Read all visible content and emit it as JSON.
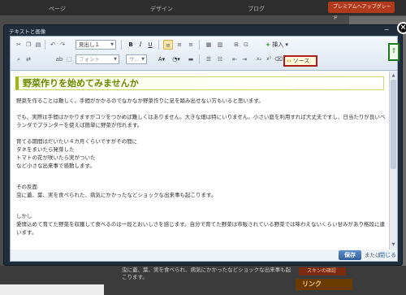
{
  "background": {
    "tabs": [
      "ページ",
      "デザイン",
      "ブログ"
    ],
    "premium_label": "プレミアムへアップグレード",
    "page_text": "虫に蓋、葉、実を食べられ、病気にかかったなどショックな出来事も起こります。",
    "sidebar_box": "スキンの確認",
    "link_heading": "リンク"
  },
  "dialog": {
    "title": "テキストと画像",
    "minimize_icon": "minus-icon",
    "close_icon": "close-icon"
  },
  "toolbar": {
    "format_select": "見出し１",
    "font_select": "フォント",
    "size_select": "サ...",
    "insert_label": "挿入",
    "source_label": "ソース",
    "icons": [
      "cut-icon",
      "copy-icon",
      "paste-icon",
      "undo-icon",
      "redo-icon",
      "bold-icon",
      "italic-icon",
      "underline-icon",
      "align-left-icon",
      "align-center-icon",
      "align-right-icon",
      "image-icon",
      "table-icon",
      "insert-plus-icon",
      "paste-text-icon",
      "paste-word-icon",
      "find-icon",
      "replace-icon",
      "font-color-icon",
      "background-color-icon",
      "strike-icon",
      "bullet-list-icon",
      "numbered-list-icon",
      "outdent-icon",
      "indent-icon",
      "subscript-icon",
      "superscript-icon",
      "eraser-icon",
      "quote-icon",
      "source-icon",
      "upload-icon"
    ]
  },
  "content": {
    "heading": "野菜作りを始めてみませんか",
    "paragraphs": [
      "野菜を作ることは難しく、手間がかかるのでなかなか野菜作りに足を踏み出せない方もいると思います。",
      "でも、実際は手間はかかりますがコツをつかめば難しくはありません。大きな畑は特にいりません。小さい庭を利用すれば大丈夫ですし、日当たりが良いベランダでプランターを使えば簡単に野菜が作れます。",
      "育てる期間はだいたい４カ月くらいですがその間に",
      "タネをまいたら発芽した",
      "トマトの花が咲いたら実がついた",
      "など小さな出来事で感動します。",
      "その反面",
      "虫に蓋、葉、実を食べられた、病気にかかったなどショックな出来事も起こります。",
      "しかし",
      "愛情込めて育てた野菜を収穫して食べるのは一段とおいしさを感じます。自分で育てた野菜は市販されている野菜では味わえないくらい甘みがあり格段に違います。"
    ]
  },
  "footer": {
    "save_label": "保存",
    "or_label": "または",
    "close_label": "閉じる"
  },
  "colors": {
    "heading_text": "#6a8a00",
    "source_highlight": "#b31b1b",
    "green_highlight": "#1d7a1d",
    "save_button": "#3a6bab"
  }
}
